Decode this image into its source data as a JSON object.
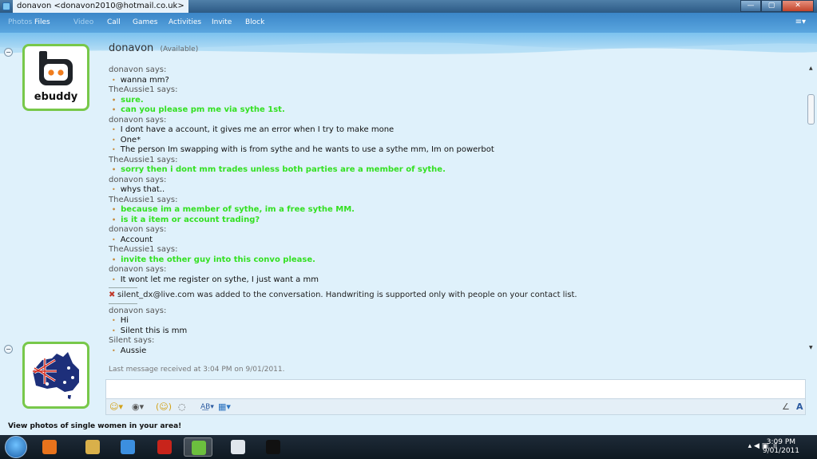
{
  "window": {
    "title": "donavon <donavon2010@hotmail.co.uk>",
    "buttons": {
      "minimize": "—",
      "maximize": "▢",
      "close": "✕"
    }
  },
  "toolbar": {
    "items": [
      {
        "label": "Photos",
        "enabled": false
      },
      {
        "label": "Files",
        "enabled": true
      },
      {
        "label": "Video",
        "enabled": false
      },
      {
        "label": "Call",
        "enabled": true
      },
      {
        "label": "Games",
        "enabled": true
      },
      {
        "label": "Activities",
        "enabled": true
      },
      {
        "label": "Invite",
        "enabled": true
      },
      {
        "label": "Block",
        "enabled": true
      }
    ],
    "menu_icon": "≡▾"
  },
  "header": {
    "name": "donavon",
    "status": "(Available)"
  },
  "avatars": {
    "me_brand": "ebuddy",
    "contact_picture": "australia-flag-map"
  },
  "conversation": [
    {
      "type": "says",
      "text": "donavon says:"
    },
    {
      "type": "msg",
      "style": "normal",
      "text": "wanna mm?"
    },
    {
      "type": "says",
      "text": "TheAussie1 says:"
    },
    {
      "type": "msg",
      "style": "green",
      "text": "sure."
    },
    {
      "type": "msg",
      "style": "green",
      "text": "can you please pm me via sythe 1st."
    },
    {
      "type": "says",
      "text": "donavon says:"
    },
    {
      "type": "msg",
      "style": "normal",
      "text": "I dont have a account, it gives me an error when I try to make mone"
    },
    {
      "type": "msg",
      "style": "normal",
      "text": "One*"
    },
    {
      "type": "msg",
      "style": "normal",
      "text": "The person Im swapping with is from sythe and he wants to use a sythe mm, Im on powerbot"
    },
    {
      "type": "says",
      "text": "TheAussie1 says:"
    },
    {
      "type": "msg",
      "style": "green",
      "text": "sorry then i dont mm trades unless both parties are a member of sythe."
    },
    {
      "type": "says",
      "text": "donavon says:"
    },
    {
      "type": "msg",
      "style": "normal",
      "text": "whys that.."
    },
    {
      "type": "says",
      "text": "TheAussie1 says:"
    },
    {
      "type": "msg",
      "style": "green",
      "text": "because im a member of sythe, im a free sythe MM."
    },
    {
      "type": "msg",
      "style": "green",
      "text": "is it a item or account trading?"
    },
    {
      "type": "says",
      "text": "donavon says:"
    },
    {
      "type": "msg",
      "style": "normal",
      "text": "Account"
    },
    {
      "type": "says",
      "text": "TheAussie1 says:"
    },
    {
      "type": "msg",
      "style": "green",
      "text": "invite the other guy into this convo please."
    },
    {
      "type": "says",
      "text": "donavon says:"
    },
    {
      "type": "msg",
      "style": "normal",
      "text": "It wont let me register on sythe, I just want a mm"
    },
    {
      "type": "sep"
    },
    {
      "type": "system",
      "text": "silent_dx@live.com was added to the conversation. Handwriting is supported only with people on your contact list."
    },
    {
      "type": "sep"
    },
    {
      "type": "says",
      "text": "donavon says:"
    },
    {
      "type": "msg",
      "style": "normal",
      "text": "Hi"
    },
    {
      "type": "msg",
      "style": "normal",
      "text": "Silent this is mm"
    },
    {
      "type": "says",
      "text": "Silent says:"
    },
    {
      "type": "msg",
      "style": "normal",
      "text": "Aussie"
    }
  ],
  "last_message": "Last message received at 3:04 PM on 9/01/2011.",
  "input_toolbar": {
    "emoticon": "☺▾",
    "wink": "◉▾",
    "nudge": "(☺)",
    "voice": "◌",
    "font": "A͟B▾",
    "background": "▦▾",
    "handwriting": "∠",
    "text_mode": "A"
  },
  "ad": "View photos of single women in your area!",
  "taskbar": {
    "apps": [
      {
        "name": "media-player",
        "color": "#e8731c"
      },
      {
        "name": "explorer",
        "color": "#d9b04a"
      },
      {
        "name": "internet-explorer",
        "color": "#3c8fe0"
      },
      {
        "name": "adobe-reader",
        "color": "#c8241b"
      },
      {
        "name": "messenger",
        "color": "#6cbf3e"
      },
      {
        "name": "window-app",
        "color": "#e0e6ec"
      },
      {
        "name": "command-prompt",
        "color": "#111111"
      }
    ],
    "tray_icons": "▴ ◀ ▣ .ıl",
    "time": "3:09 PM",
    "date": "9/01/2011"
  }
}
